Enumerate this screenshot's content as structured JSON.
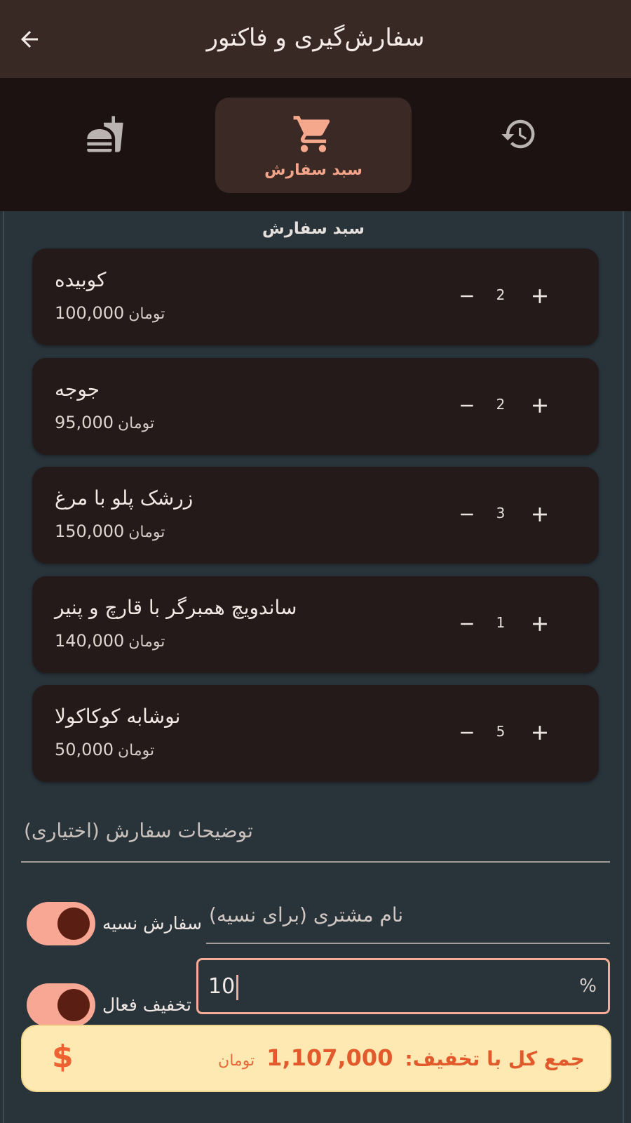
{
  "header": {
    "title": "سفارش‌گیری و فاکتور",
    "back_icon": "arrow-left-icon"
  },
  "tabs": {
    "menu": {
      "icon": "fastfood-icon"
    },
    "cart": {
      "label": "سبد سفارش",
      "icon": "cart-icon",
      "active": true
    },
    "history": {
      "icon": "history-icon"
    }
  },
  "cart": {
    "title": "سبد سفارش",
    "currency": "تومان",
    "items": [
      {
        "name": "کوبیده",
        "price": "100,000",
        "qty": "2"
      },
      {
        "name": "جوجه",
        "price": "95,000",
        "qty": "2"
      },
      {
        "name": "زرشک پلو با مرغ",
        "price": "150,000",
        "qty": "3"
      },
      {
        "name": "ساندویچ همبرگر با قارچ و پنیر",
        "price": "140,000",
        "qty": "1"
      },
      {
        "name": "نوشابه کوکاکولا",
        "price": "50,000",
        "qty": "5"
      }
    ]
  },
  "notes": {
    "placeholder": "توضیحات سفارش (اختیاری)"
  },
  "credit": {
    "toggle_label": "سفارش نسیه",
    "toggle_on": true,
    "customer_placeholder": "نام مشتری (برای نسیه)"
  },
  "discount": {
    "toggle_label": "تخفیف فعال",
    "toggle_on": true,
    "value": "10",
    "suffix": "%"
  },
  "total": {
    "label": "جمع کل با تخفیف:",
    "amount": "1,107,000",
    "currency": "تومان",
    "icon": "$"
  },
  "colors": {
    "accent": "#f4a589",
    "app_bar": "#382925",
    "card": "#231a19",
    "total_bg": "#fde9b1",
    "total_text": "#e25a2b"
  }
}
